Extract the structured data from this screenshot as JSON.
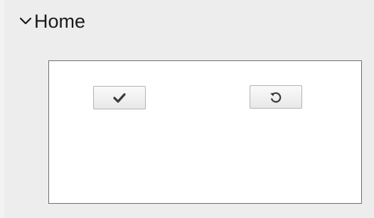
{
  "section": {
    "title": "Home",
    "icon": "chevron-down-icon"
  },
  "toolbar": {
    "apply_icon": "checkmark-icon",
    "reset_icon": "undo-icon"
  }
}
